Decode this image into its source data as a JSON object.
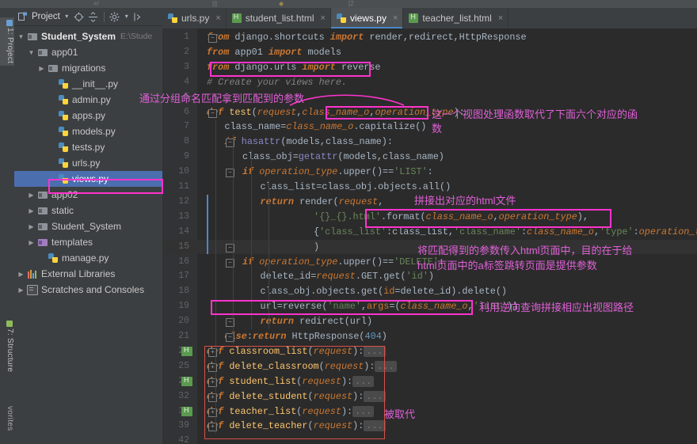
{
  "window": {
    "theme_bg": "#3c3f41",
    "editor_bg": "#2b2b2b",
    "accent": "#4b6eaf",
    "annotation_color": "#ff33cc"
  },
  "left_strip": {
    "buttons": [
      {
        "label": "1: Project",
        "icon": "project-icon",
        "active": true
      },
      {
        "label": "7: Structure",
        "icon": "structure-icon",
        "active": false
      },
      {
        "label": "vorites",
        "icon": "favorites-icon",
        "active": false
      }
    ]
  },
  "project_panel": {
    "toolbar": {
      "title": "Project",
      "dropdown_glyph": "▾",
      "icons": [
        "target-icon",
        "collapse-all-icon",
        "settings-gear-icon",
        "hide-panel-icon"
      ]
    },
    "tree": [
      {
        "depth": 0,
        "arrow": "▼",
        "icon": "folder-icon",
        "label": "Student_System",
        "path": "E:\\Stude",
        "bold": true,
        "selected": false
      },
      {
        "depth": 1,
        "arrow": "▼",
        "icon": "folder-icon",
        "label": "app01",
        "path": "",
        "bold": false,
        "selected": false
      },
      {
        "depth": 2,
        "arrow": "▶",
        "icon": "folder-icon",
        "label": "migrations",
        "path": "",
        "bold": false,
        "selected": false
      },
      {
        "depth": 3,
        "arrow": "",
        "icon": "python-file-icon",
        "label": "__init__.py",
        "path": "",
        "bold": false,
        "selected": false
      },
      {
        "depth": 3,
        "arrow": "",
        "icon": "python-file-icon",
        "label": "admin.py",
        "path": "",
        "bold": false,
        "selected": false
      },
      {
        "depth": 3,
        "arrow": "",
        "icon": "python-file-icon",
        "label": "apps.py",
        "path": "",
        "bold": false,
        "selected": false
      },
      {
        "depth": 3,
        "arrow": "",
        "icon": "python-file-icon",
        "label": "models.py",
        "path": "",
        "bold": false,
        "selected": false
      },
      {
        "depth": 3,
        "arrow": "",
        "icon": "python-file-icon",
        "label": "tests.py",
        "path": "",
        "bold": false,
        "selected": false
      },
      {
        "depth": 3,
        "arrow": "",
        "icon": "python-file-icon",
        "label": "urls.py",
        "path": "",
        "bold": false,
        "selected": false
      },
      {
        "depth": 3,
        "arrow": "",
        "icon": "python-file-icon",
        "label": "views.py",
        "path": "",
        "bold": false,
        "selected": true
      },
      {
        "depth": 1,
        "arrow": "▶",
        "icon": "folder-icon",
        "label": "app02",
        "path": "",
        "bold": false,
        "selected": false
      },
      {
        "depth": 1,
        "arrow": "▶",
        "icon": "folder-icon",
        "label": "static",
        "path": "",
        "bold": false,
        "selected": false
      },
      {
        "depth": 1,
        "arrow": "▶",
        "icon": "folder-icon",
        "label": "Student_System",
        "path": "",
        "bold": false,
        "selected": false
      },
      {
        "depth": 1,
        "arrow": "▶",
        "icon": "folder-purple-icon",
        "label": "templates",
        "path": "",
        "bold": false,
        "selected": false
      },
      {
        "depth": 2,
        "arrow": "",
        "icon": "python-file-icon",
        "label": "manage.py",
        "path": "",
        "bold": false,
        "selected": false
      },
      {
        "depth": 0,
        "arrow": "▶",
        "icon": "external-libraries-icon",
        "label": "External Libraries",
        "path": "",
        "bold": false,
        "selected": false
      },
      {
        "depth": 0,
        "arrow": "▶",
        "icon": "scratches-icon",
        "label": "Scratches and Consoles",
        "path": "",
        "bold": false,
        "selected": false
      }
    ]
  },
  "editor": {
    "tabs": [
      {
        "label": "urls.py",
        "icon": "python-file-icon",
        "active": false,
        "close": "×"
      },
      {
        "label": "student_list.html",
        "icon": "html-file-icon",
        "active": false,
        "close": "×"
      },
      {
        "label": "views.py",
        "icon": "python-file-icon",
        "active": true,
        "close": "×"
      },
      {
        "label": "teacher_list.html",
        "icon": "html-file-icon",
        "active": false,
        "close": "×"
      }
    ],
    "lines": [
      {
        "n": "1",
        "indent": 0,
        "html": "<span class=\"kw\">from</span> <span class=\"mod\">django.shortcuts</span> <span class=\"kw\">import</span> render,redirect,HttpResponse"
      },
      {
        "n": "2",
        "indent": 0,
        "html": "<span class=\"kw\">from</span> <span class=\"mod\">app01</span> <span class=\"kw\">import</span> models"
      },
      {
        "n": "3",
        "indent": 0,
        "html": "<span class=\"kw\">from</span> <span class=\"mod\">django.urls</span> <span class=\"kw\">import</span> reverse"
      },
      {
        "n": "4",
        "indent": 0,
        "html": "<span class=\"cmt\"># Create your views here.</span>"
      },
      {
        "n": "5",
        "indent": 0,
        "html": ""
      },
      {
        "n": "6",
        "indent": 0,
        "html": "<span class=\"kw\">def</span> <span class=\"fn\">test</span>(<span class=\"par\">request</span>,<span class=\"par\">class_name_o</span>,<span class=\"par\">operation_type</span>):"
      },
      {
        "n": "7",
        "indent": 1,
        "html": "class_name=<span class=\"par\">class_name_o</span>.capitalize()"
      },
      {
        "n": "8",
        "indent": 1,
        "html": "<span class=\"kw\">if</span> <span class=\"bi\">hasattr</span>(models,class_name):"
      },
      {
        "n": "9",
        "indent": 2,
        "html": "class_obj=<span class=\"bi\">getattr</span>(models,class_name)"
      },
      {
        "n": "10",
        "indent": 2,
        "html": "<span class=\"kw\">if</span> <span class=\"par\">operation_type</span>.upper()==<span class=\"str\">'LIST'</span>:"
      },
      {
        "n": "11",
        "indent": 3,
        "html": "class_list=class_obj.objects.all()"
      },
      {
        "n": "12",
        "indent": 3,
        "html": "<span class=\"kw\">return</span> render(<span class=\"par\">request</span>,"
      },
      {
        "n": "13",
        "indent": 6,
        "html": "<span class=\"str\">'{}_{}.html'</span>.format(<span class=\"par\">class_name_o</span>,<span class=\"par\">operation_type</span>),"
      },
      {
        "n": "14",
        "indent": 6,
        "html": "{<span class=\"str\">'class_list'</span>:class_list,<span class=\"str\">'class_name'</span>:<span class=\"par\">class_name_o</span>,<span class=\"str\">'type'</span>:<span class=\"par\">operation_type</span>}"
      },
      {
        "n": "15",
        "indent": 6,
        "html": ")"
      },
      {
        "n": "16",
        "indent": 2,
        "html": "<span class=\"kw\">if</span> <span class=\"par\">operation_type</span>.upper()==<span class=\"str\">'DELETE'</span>:"
      },
      {
        "n": "17",
        "indent": 3,
        "html": "delete_id=<span class=\"par\">request</span>.GET.get(<span class=\"str\">'id'</span>)"
      },
      {
        "n": "18",
        "indent": 3,
        "html": "class_obj.objects.get(<span class=\"kw2\">id</span>=delete_id).delete()"
      },
      {
        "n": "19",
        "indent": 3,
        "html": "url=reverse(<span class=\"str\">'name'</span>,<span class=\"kw2\">args</span>=(<span class=\"par\">class_name_o</span>,<span class=\"str\">'list'</span>))"
      },
      {
        "n": "20",
        "indent": 3,
        "html": "<span class=\"kw\">return</span> redirect(url)"
      },
      {
        "n": "21",
        "indent": 1,
        "html": "<span class=\"kw\">else</span>:<span class=\"kw\">return</span> HttpResponse(<span class=\"num\">404</span>)"
      },
      {
        "n": "22",
        "indent": 0,
        "html": "<span class=\"kw\">def</span> <span class=\"fn\">classroom_list</span>(<span class=\"par\">request</span>):<span class=\"dots\">...</span>",
        "gutter_html": true
      },
      {
        "n": "25",
        "indent": 0,
        "html": "<span class=\"kw\">def</span> <span class=\"fn\">delete_classroom</span>(<span class=\"par\">request</span>):<span class=\"dots\">...</span>",
        "gutter_html": false
      },
      {
        "n": "29",
        "indent": 0,
        "html": "<span class=\"kw\">def</span> <span class=\"fn\">student_list</span>(<span class=\"par\">request</span>):<span class=\"dots\">...</span>",
        "gutter_html": true
      },
      {
        "n": "32",
        "indent": 0,
        "html": "<span class=\"kw\">def</span> <span class=\"fn\">delete_student</span>(<span class=\"par\">request</span>):<span class=\"dots\">...</span>",
        "gutter_html": false
      },
      {
        "n": "36",
        "indent": 0,
        "html": "<span class=\"kw\">def</span> <span class=\"fn\">teacher_list</span>(<span class=\"par\">request</span>):<span class=\"dots\">...</span>",
        "gutter_html": true
      },
      {
        "n": "39",
        "indent": 0,
        "html": "<span class=\"kw\">def</span> <span class=\"fn\">delete_teacher</span>(<span class=\"par\">request</span>):<span class=\"dots\">...</span>",
        "gutter_html": false
      },
      {
        "n": "42",
        "indent": 0,
        "html": ""
      }
    ],
    "current_line": "15"
  },
  "annotations": [
    {
      "id": "a1",
      "text": "通过分组命名匹配拿到匹配到的参数"
    },
    {
      "id": "a2",
      "text": "这一个视图处理函数取代了下面六个对应的函"
    },
    {
      "id": "a3",
      "text": "数"
    },
    {
      "id": "a4",
      "text": "拼接出对应的html文件"
    },
    {
      "id": "a5",
      "text": "将匹配得到的参数传入html页面中，目的在于给"
    },
    {
      "id": "a6",
      "text": "html页面中的a标签跳转页面是提供参数"
    },
    {
      "id": "a7",
      "text": "利用逆向查询拼接相应出视图路径"
    },
    {
      "id": "a8",
      "text": "被取代"
    }
  ]
}
